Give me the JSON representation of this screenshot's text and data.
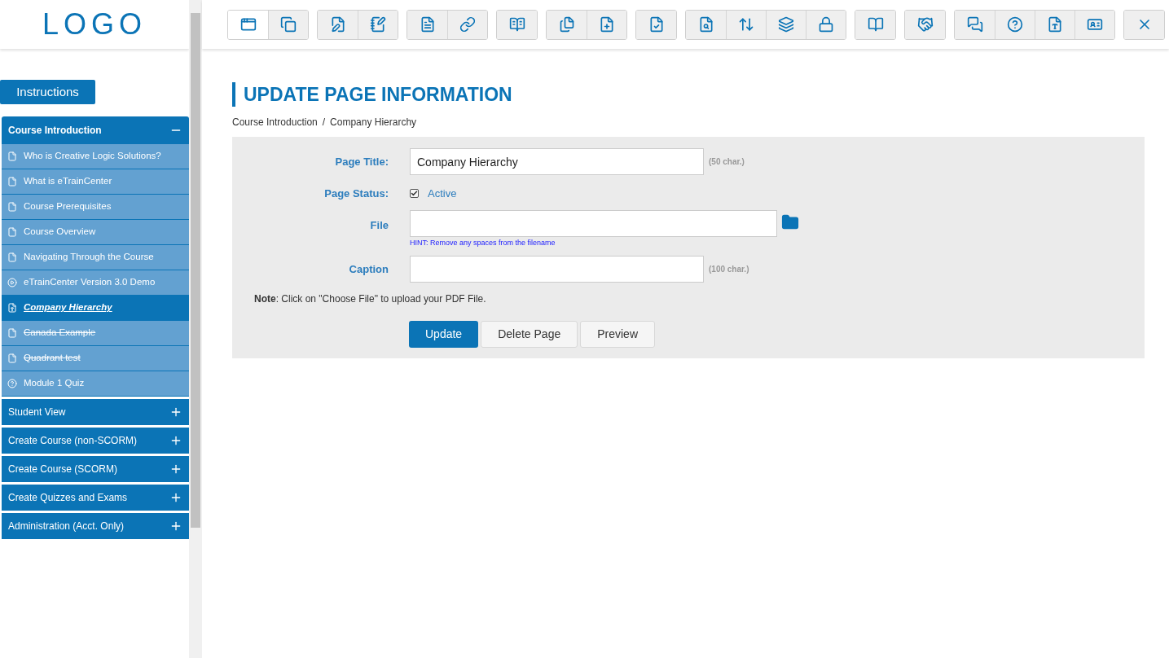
{
  "logo": "LOGO",
  "instructions_button": "Instructions",
  "toolbar": [
    {
      "buttons": [
        {
          "kind": "new-window",
          "selected": true
        },
        {
          "kind": "copy",
          "selected": false
        }
      ]
    },
    {
      "buttons": [
        {
          "kind": "edit-doc",
          "selected": false
        },
        {
          "kind": "notepad",
          "selected": false
        }
      ]
    },
    {
      "buttons": [
        {
          "kind": "doc",
          "selected": false
        },
        {
          "kind": "link",
          "selected": false
        }
      ]
    },
    {
      "buttons": [
        {
          "kind": "reader",
          "selected": false
        }
      ]
    },
    {
      "buttons": [
        {
          "kind": "docs",
          "selected": false
        },
        {
          "kind": "doc-add",
          "selected": false
        }
      ]
    },
    {
      "buttons": [
        {
          "kind": "doc-check",
          "selected": false
        }
      ]
    },
    {
      "buttons": [
        {
          "kind": "doc-search",
          "selected": false
        },
        {
          "kind": "sort",
          "selected": false
        },
        {
          "kind": "layers",
          "selected": false
        },
        {
          "kind": "lock",
          "selected": false
        }
      ]
    },
    {
      "buttons": [
        {
          "kind": "book",
          "selected": false
        }
      ]
    },
    {
      "buttons": [
        {
          "kind": "handshake",
          "selected": false
        }
      ]
    },
    {
      "buttons": [
        {
          "kind": "chat",
          "selected": false
        },
        {
          "kind": "help",
          "selected": false
        },
        {
          "kind": "pdf",
          "selected": false
        },
        {
          "kind": "id-card",
          "selected": false
        }
      ]
    },
    {
      "buttons": [
        {
          "kind": "close",
          "selected": false
        }
      ]
    }
  ],
  "sidebar": [
    {
      "label": "Course Introduction",
      "expanded": true,
      "children": [
        {
          "label": "Who is Creative Logic Solutions?",
          "kind": "page",
          "selected": false,
          "inactive": false
        },
        {
          "label": "What is eTrainCenter",
          "kind": "page",
          "selected": false,
          "inactive": false
        },
        {
          "label": "Course Prerequisites",
          "kind": "page",
          "selected": false,
          "inactive": false
        },
        {
          "label": "Course Overview",
          "kind": "page",
          "selected": false,
          "inactive": false
        },
        {
          "label": "Navigating Through the Course",
          "kind": "page",
          "selected": false,
          "inactive": false
        },
        {
          "label": "eTrainCenter Version 3.0 Demo",
          "kind": "video",
          "selected": false,
          "inactive": false
        },
        {
          "label": "Company Hierarchy",
          "kind": "pdf",
          "selected": true,
          "inactive": false
        },
        {
          "label": "Canada Example",
          "kind": "page",
          "selected": false,
          "inactive": true
        },
        {
          "label": "Quadrant test",
          "kind": "page",
          "selected": false,
          "inactive": true
        },
        {
          "label": "Module 1 Quiz",
          "kind": "quiz",
          "selected": false,
          "inactive": false
        }
      ]
    },
    {
      "label": "Student View",
      "expanded": false
    },
    {
      "label": "Create Course (non-SCORM)",
      "expanded": false
    },
    {
      "label": "Create Course (SCORM)",
      "expanded": false
    },
    {
      "label": "Create Quizzes and Exams",
      "expanded": false
    },
    {
      "label": "Administration (Acct. Only)",
      "expanded": false
    }
  ],
  "page_heading": "UPDATE PAGE INFORMATION",
  "breadcrumb": [
    "Course Introduction",
    "Company Hierarchy"
  ],
  "breadcrumb_separator": "/",
  "form": {
    "page_title": {
      "label": "Page Title:",
      "value": "Company Hierarchy",
      "limit": "(50 char.)"
    },
    "page_status": {
      "label": "Page Status:",
      "checked": true,
      "option": "Active"
    },
    "file": {
      "label": "File",
      "hint": "HINT: Remove any spaces from the filename"
    },
    "caption": {
      "label": "Caption",
      "limit": "(100 char.)"
    },
    "note": "**Note**: Click on \"Choose File\" to upload your PDF File.",
    "buttons": [
      {
        "label": "Update",
        "kind": "primary"
      },
      {
        "label": "Delete Page",
        "kind": "secondary"
      },
      {
        "label": "Preview",
        "kind": "secondary"
      }
    ]
  }
}
